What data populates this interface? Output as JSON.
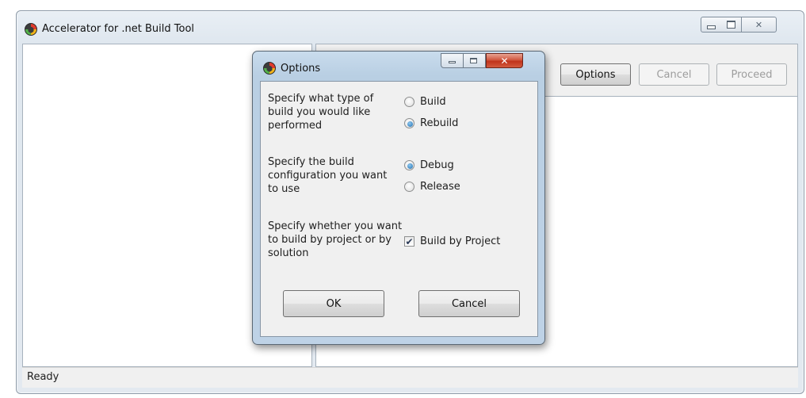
{
  "window": {
    "title": "Accelerator for .net Build Tool",
    "controls": {
      "minimize": "minimize",
      "maximize": "maximize",
      "close": "close"
    }
  },
  "toolbar": {
    "options_label": "Options",
    "cancel_label": "Cancel",
    "proceed_label": "Proceed"
  },
  "status": {
    "text": "Ready"
  },
  "dialog": {
    "title": "Options",
    "build_type": {
      "description": "Specify what type of build you would like performed",
      "options": [
        {
          "label": "Build",
          "checked": false
        },
        {
          "label": "Rebuild",
          "checked": true
        }
      ]
    },
    "configuration": {
      "description": "Specify the build configuration you want to use",
      "options": [
        {
          "label": "Debug",
          "checked": true
        },
        {
          "label": "Release",
          "checked": false
        }
      ]
    },
    "build_by": {
      "description": "Specify whether you want to build by project or by solution",
      "checkbox_label": "Build by Project",
      "checked": true
    },
    "ok_label": "OK",
    "cancel_label": "Cancel"
  },
  "icons": {
    "app_icon": "app-logo-icon",
    "check_glyph": "✔"
  }
}
